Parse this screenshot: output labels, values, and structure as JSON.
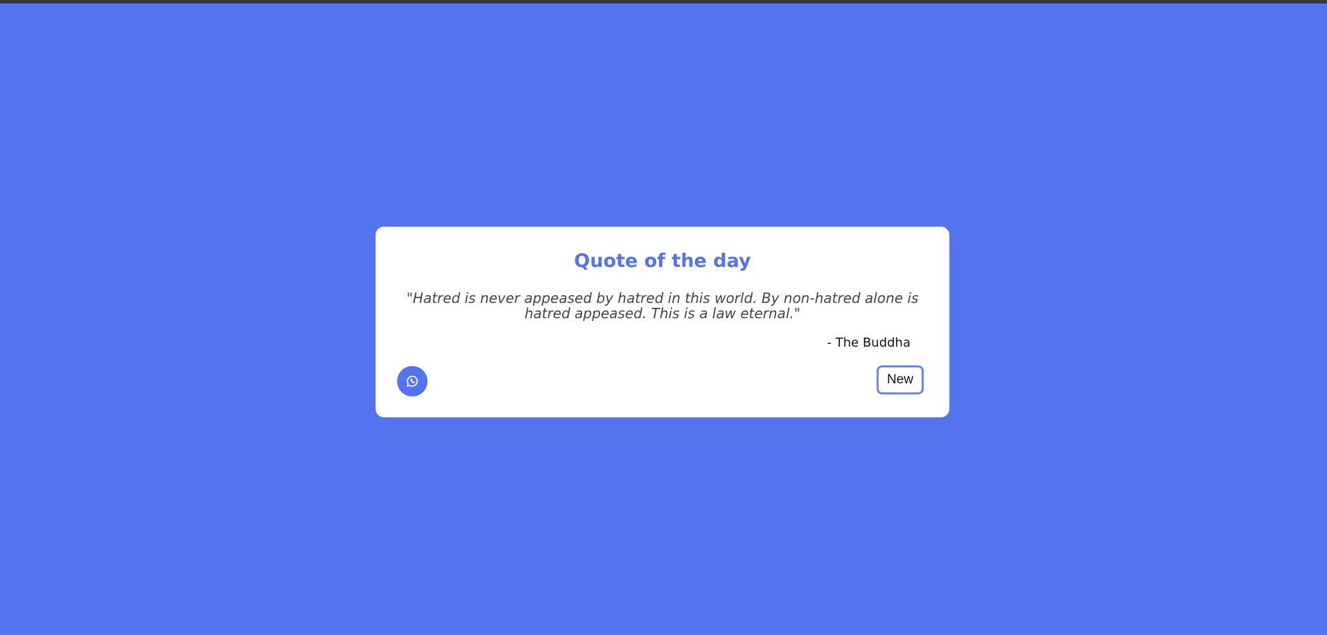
{
  "page": {
    "background_color": "#5474ef",
    "accent_color": "#5474ef"
  },
  "card": {
    "title": "Quote of the day",
    "quote": "\"Hatred is never appeased by hatred in this world. By non-hatred alone is hatred appeased. This is a law eternal.\"",
    "author": "- The Buddha",
    "share_icon": "whatsapp-icon",
    "new_button_label": "New"
  }
}
